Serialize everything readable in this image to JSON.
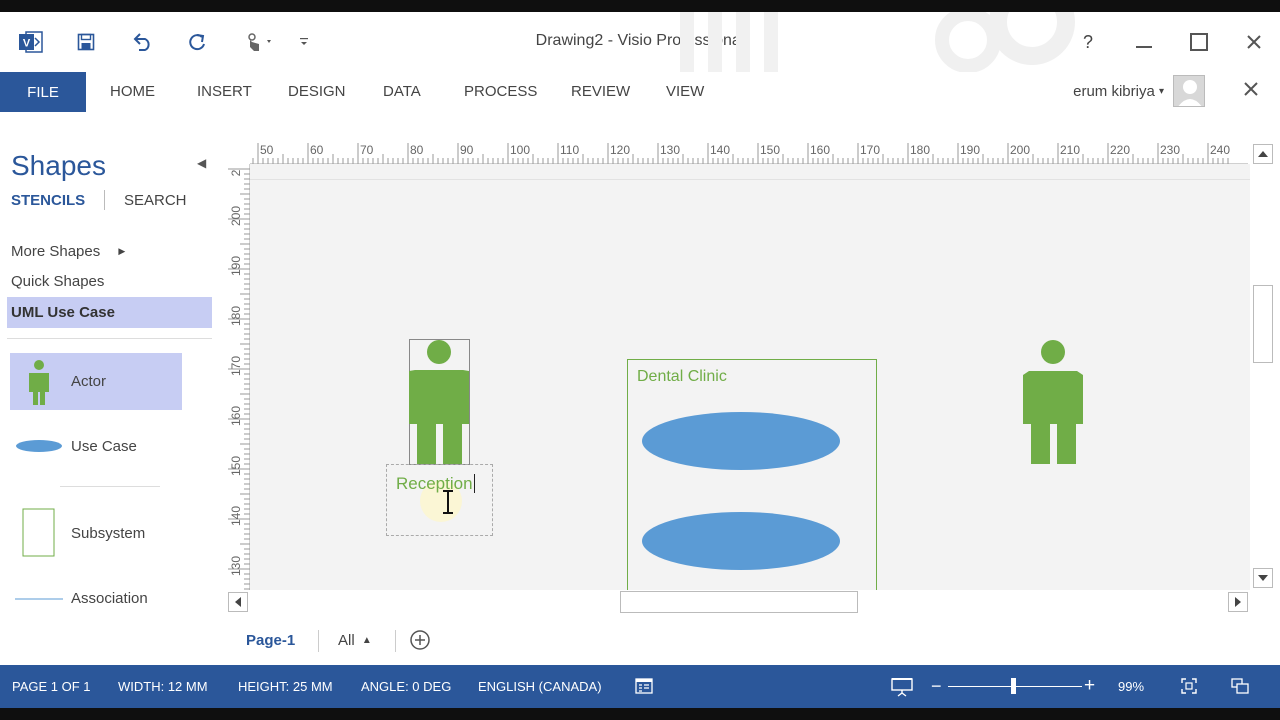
{
  "window": {
    "title": "Drawing2 - Visio Professional"
  },
  "ribbon": {
    "file_label": "FILE",
    "tabs": [
      "HOME",
      "INSERT",
      "DESIGN",
      "DATA",
      "PROCESS",
      "REVIEW",
      "VIEW"
    ],
    "user_name": "erum kibriya"
  },
  "shapes_pane": {
    "title": "Shapes",
    "stencils_label": "STENCILS",
    "search_label": "SEARCH",
    "more_shapes": "More Shapes",
    "quick_shapes": "Quick Shapes",
    "selected_stencil": "UML Use Case",
    "items": [
      "Actor",
      "Use Case",
      "Subsystem",
      "Association"
    ]
  },
  "ruler": {
    "top_labels": [
      "50",
      "60",
      "70",
      "80",
      "90",
      "100",
      "110",
      "120",
      "130",
      "140",
      "150",
      "160",
      "170",
      "180",
      "190",
      "200",
      "210",
      "220",
      "230",
      "240"
    ],
    "left_labels": [
      "2",
      "200",
      "190",
      "180",
      "170",
      "160",
      "150",
      "140",
      "130"
    ]
  },
  "canvas": {
    "subsystem_label": "Dental Clinic",
    "actor_text": "Reception"
  },
  "page_tabs": {
    "active": "Page-1",
    "all_label": "All"
  },
  "status_bar": {
    "page": "PAGE 1 OF 1",
    "width": "WIDTH: 12 MM",
    "height": "HEIGHT: 25 MM",
    "angle": "ANGLE: 0 DEG",
    "language": "ENGLISH (CANADA)",
    "zoom": "99%"
  },
  "colors": {
    "brand": "#2b579a",
    "shape_green": "#70ad47",
    "usecase_blue": "#5b9bd5",
    "stencil_selected": "#c7cdf3"
  }
}
